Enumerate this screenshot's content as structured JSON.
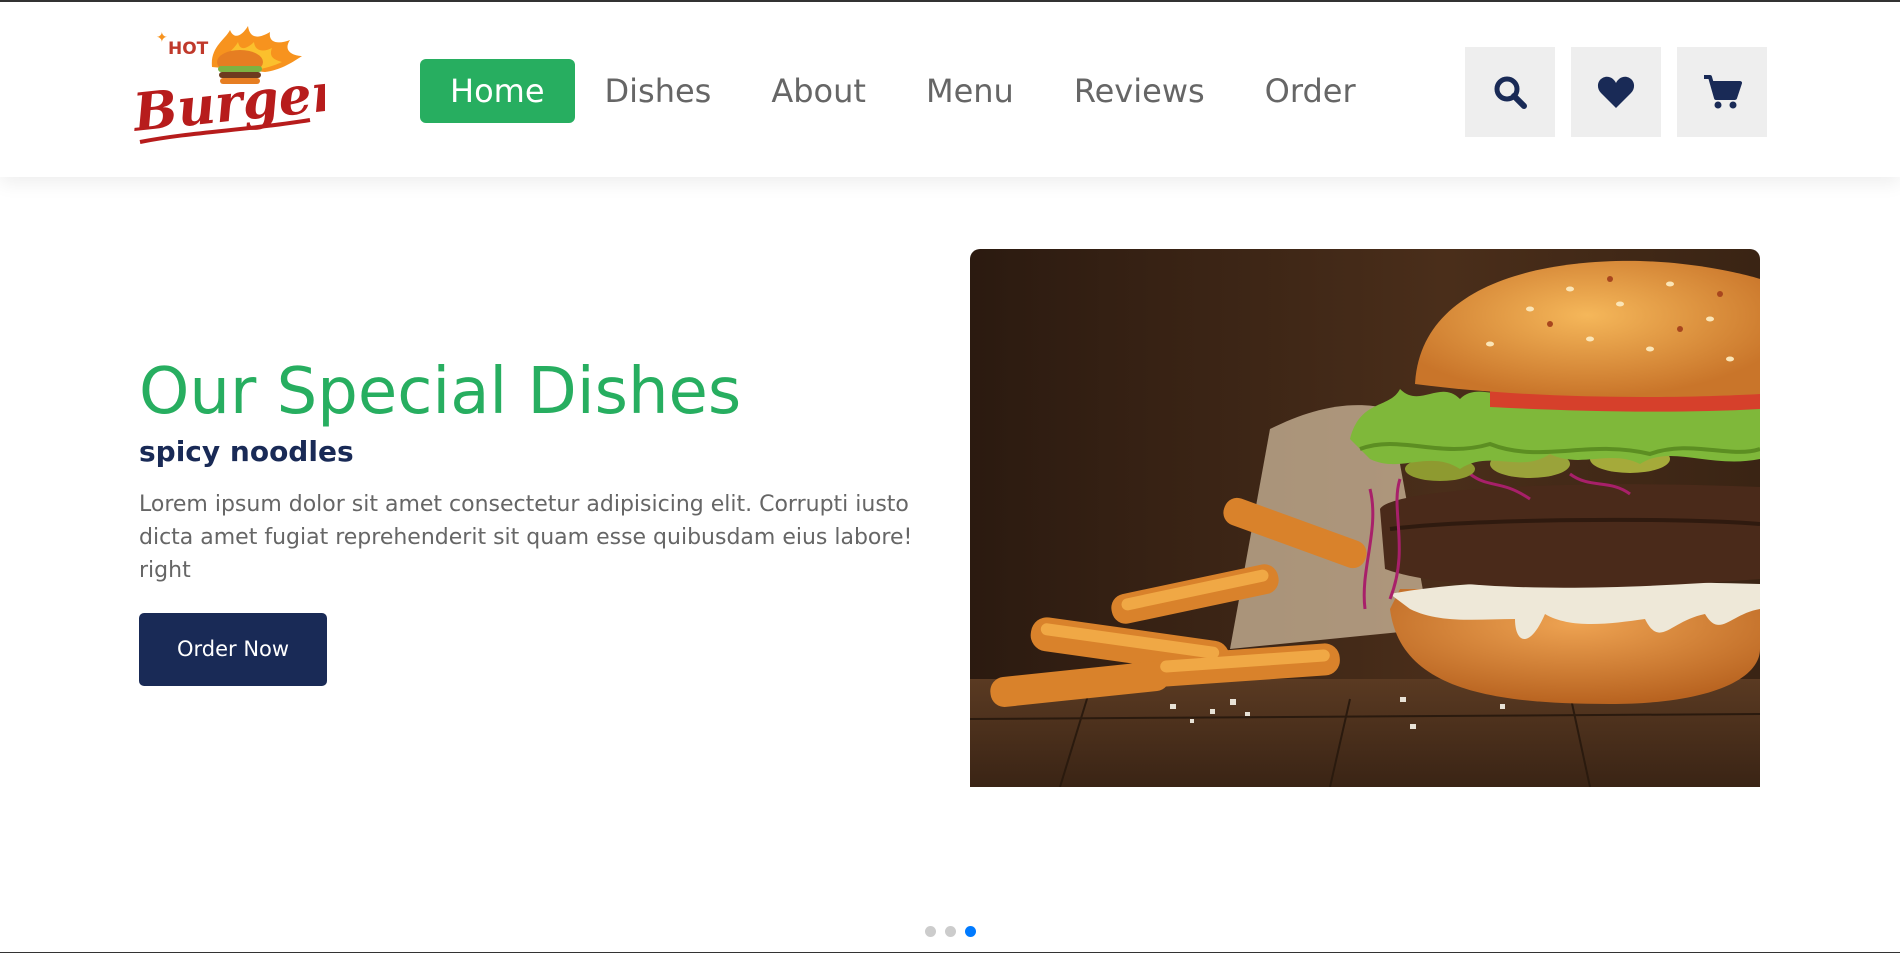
{
  "brand": {
    "logo_top": "HOT",
    "logo_main": "Burgers"
  },
  "nav": {
    "items": [
      {
        "label": "Home",
        "active": true
      },
      {
        "label": "Dishes",
        "active": false
      },
      {
        "label": "About",
        "active": false
      },
      {
        "label": "Menu",
        "active": false
      },
      {
        "label": "Reviews",
        "active": false
      },
      {
        "label": "Order",
        "active": false
      }
    ]
  },
  "header_icons": [
    "search-icon",
    "heart-icon",
    "cart-icon"
  ],
  "hero": {
    "title": "Our Special Dishes",
    "subtitle": "spicy noodles",
    "description": "Lorem ipsum dolor sit amet consectetur adipisicing elit. Corrupti iusto dicta amet fugiat reprehenderit sit quam esse quibusdam eius labore! right",
    "button_label": "Order Now"
  },
  "slider": {
    "total": 3,
    "active_index": 2
  },
  "colors": {
    "accent": "#27ae60",
    "navy": "#192a56",
    "active_dot": "#007aff"
  }
}
